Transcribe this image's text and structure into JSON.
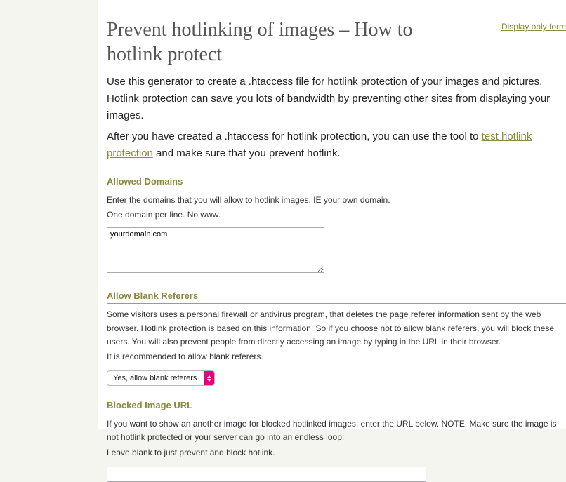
{
  "header": {
    "title": "Prevent hotlinking of images – How to hotlink protect",
    "display_link": "Display only form"
  },
  "intro": {
    "p1": "Use this generator to create a .htaccess file for hotlink protection of your images and pictures. Hotlink protection can save you lots of bandwidth by preventing other sites from displaying your images.",
    "p2_before": "After you have created a .htaccess for hotlink protection, you can use the tool to ",
    "p2_link": "test hotlink protection",
    "p2_after": " and make sure that you prevent hotlink."
  },
  "allowed_domains": {
    "title": "Allowed Domains",
    "help1": "Enter the domains that you will allow to hotlink images. IE your own domain.",
    "help2": "One domain per line. No www.",
    "value": "yourdomain.com"
  },
  "blank_referers": {
    "title": "Allow Blank Referers",
    "help1": "Some visitors uses a personal firewall or antivirus program, that deletes the page referer information sent by the web browser. Hotlink protection is based on this information. So if you choose not to allow blank referers, you will block these users. You will also prevent people from directly accessing an image by typing in the URL in their browser.",
    "help2": "It is recommended to allow blank referers.",
    "selected": "Yes, allow blank referers"
  },
  "blocked_url": {
    "title": "Blocked Image URL",
    "help1": "If you want to show an another image for blocked hotlinked images, enter the URL below. NOTE: Make sure the image is not hotlink protected or your server can go into an endless loop.",
    "help2": "Leave blank to just prevent and block hotlink.",
    "value": ""
  }
}
